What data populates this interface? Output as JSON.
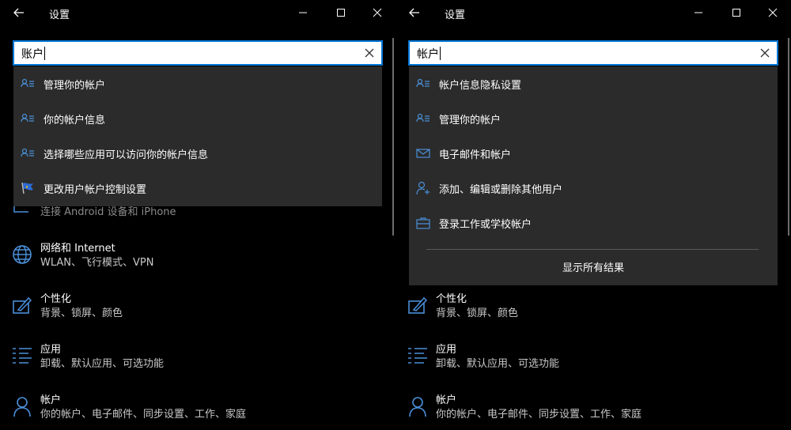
{
  "left": {
    "title": "设置",
    "search": {
      "value": "账户"
    },
    "results": [
      {
        "label": "管理你的帐户",
        "icon": "person-list-icon"
      },
      {
        "label": "你的帐户信息",
        "icon": "person-list-icon"
      },
      {
        "label": "选择哪些应用可以访问你的帐户信息",
        "icon": "person-list-icon"
      },
      {
        "label": "更改用户帐户控制设置",
        "icon": "flag-icon"
      }
    ],
    "partial_sub": "连接 Android 设备和 iPhone",
    "categories": [
      {
        "title": "网络和 Internet",
        "sub": "WLAN、飞行模式、VPN",
        "icon": "globe-icon"
      },
      {
        "title": "个性化",
        "sub": "背景、锁屏、颜色",
        "icon": "brush-icon"
      },
      {
        "title": "应用",
        "sub": "卸载、默认应用、可选功能",
        "icon": "apps-list-icon"
      },
      {
        "title": "帐户",
        "sub": "你的帐户、电子邮件、同步设置、工作、家庭",
        "icon": "person-icon"
      }
    ]
  },
  "right": {
    "title": "设置",
    "search": {
      "value": "帐户"
    },
    "results": [
      {
        "label": "帐户信息隐私设置",
        "icon": "person-list-icon"
      },
      {
        "label": "管理你的帐户",
        "icon": "person-list-icon"
      },
      {
        "label": "电子邮件和帐户",
        "icon": "mail-icon"
      },
      {
        "label": "添加、编辑或删除其他用户",
        "icon": "person-add-icon"
      },
      {
        "label": "登录工作或学校帐户",
        "icon": "briefcase-icon"
      }
    ],
    "show_all": "显示所有结果",
    "categories": [
      {
        "title": "个性化",
        "sub": "背景、锁屏、颜色",
        "icon": "brush-icon"
      },
      {
        "title": "应用",
        "sub": "卸载、默认应用、可选功能",
        "icon": "apps-list-icon"
      },
      {
        "title": "帐户",
        "sub": "你的帐户、电子邮件、同步设置、工作、家庭",
        "icon": "person-icon"
      }
    ]
  },
  "colors": {
    "accent": "#0078d7",
    "icon_blue": "#4a8fd8",
    "dropdown_bg": "#2b2b2b"
  }
}
